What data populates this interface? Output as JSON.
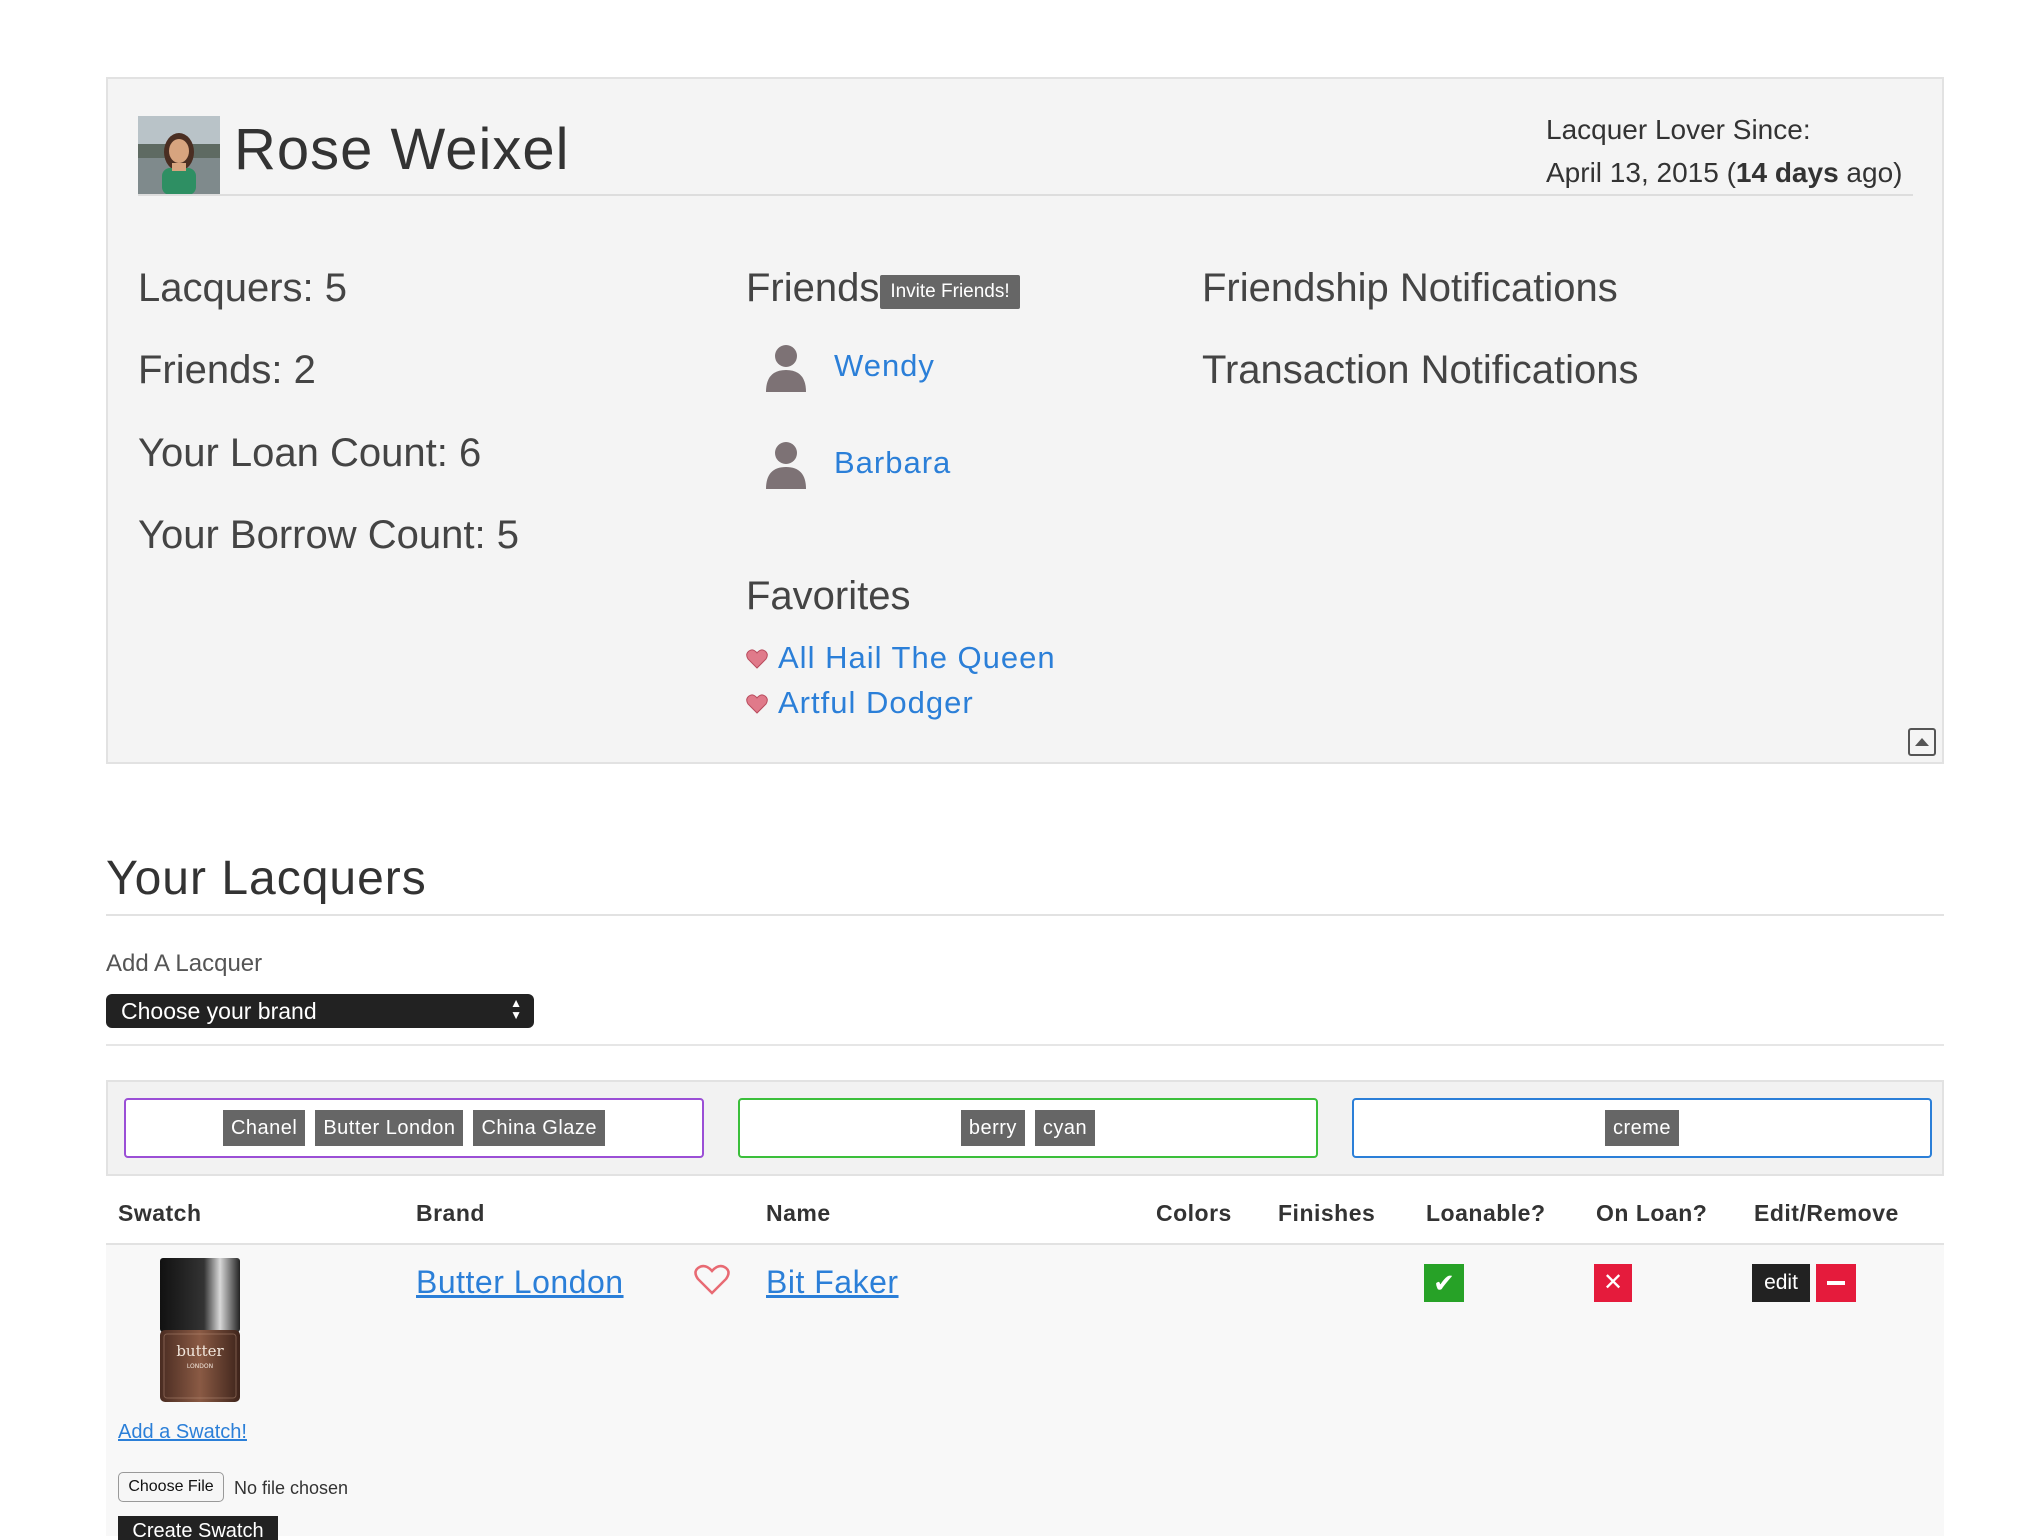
{
  "profile": {
    "name": "Rose Weixel",
    "since_label": "Lacquer Lover Since:",
    "since_date": "April 13, 2015 (",
    "since_days": "14 days",
    "since_suffix": " ago)",
    "stats": {
      "lacquers": "Lacquers: 5",
      "friends": "Friends: 2",
      "loan_count": "Your Loan Count: 6",
      "borrow_count": "Your Borrow Count: 5"
    },
    "friends_heading": "Friends",
    "invite_label": "Invite Friends!",
    "friends": [
      "Wendy",
      "Barbara"
    ],
    "favorites_heading": "Favorites",
    "favorites": [
      "All Hail The Queen",
      "Artful Dodger"
    ],
    "friendship_notifications": "Friendship Notifications",
    "transaction_notifications": "Transaction Notifications"
  },
  "lacquers": {
    "title": "Your Lacquers",
    "add_label": "Add A Lacquer",
    "brand_select": "Choose your brand",
    "filters": {
      "brands": [
        "Chanel",
        "Butter London",
        "China Glaze"
      ],
      "colors": [
        "berry",
        "cyan"
      ],
      "finishes": [
        "creme"
      ]
    },
    "filter_colors": {
      "brands": "#9b4fd6",
      "colors": "#3bbf3b",
      "finishes": "#2b7fd8"
    },
    "columns": [
      "Swatch",
      "Brand",
      "Name",
      "Colors",
      "Finishes",
      "Loanable?",
      "On Loan?",
      "Edit/Remove"
    ],
    "rows": [
      {
        "brand": "Butter London",
        "name": "Bit Faker",
        "loanable": "✔",
        "on_loan": "✕",
        "add_swatch": "Add a Swatch!",
        "choose_file": "Choose File",
        "no_file": "No file chosen",
        "create_swatch": "Create Swatch",
        "edit": "edit"
      }
    ]
  },
  "colors": {
    "link": "#2b7fd8",
    "success": "#27a227",
    "danger": "#e51b3c"
  },
  "icons": [
    "person-icon",
    "heart-icon",
    "collapse-icon",
    "checkmark-icon",
    "x-icon",
    "minus-icon"
  ]
}
